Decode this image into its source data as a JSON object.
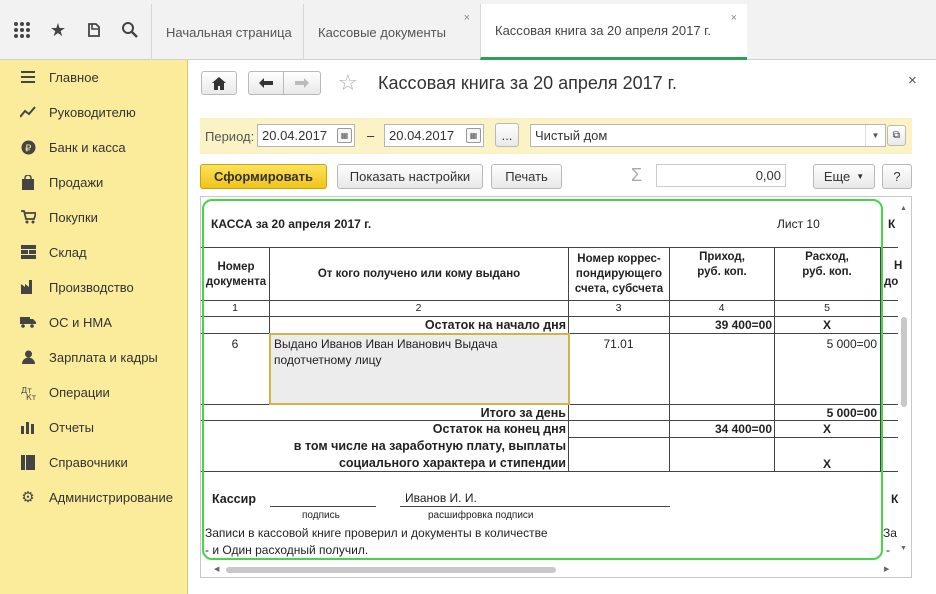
{
  "topbar": {
    "icons": [
      "grid-icon",
      "star-icon",
      "history-icon",
      "search-icon"
    ],
    "tabs": [
      {
        "label": "Начальная страница",
        "closable": false,
        "active": false
      },
      {
        "label": "Кассовые документы",
        "closable": true,
        "active": false
      },
      {
        "label": "Кассовая книга за 20 апреля 2017 г.",
        "closable": true,
        "active": true
      }
    ],
    "close_glyph": "×"
  },
  "sidebar": {
    "items": [
      {
        "label": "Главное",
        "icon": "menu-icon"
      },
      {
        "label": "Руководителю",
        "icon": "trend-icon"
      },
      {
        "label": "Банк и касса",
        "icon": "ruble-icon"
      },
      {
        "label": "Продажи",
        "icon": "bag-icon"
      },
      {
        "label": "Покупки",
        "icon": "cart-icon"
      },
      {
        "label": "Склад",
        "icon": "warehouse-icon"
      },
      {
        "label": "Производство",
        "icon": "factory-icon"
      },
      {
        "label": "ОС и НМА",
        "icon": "truck-icon"
      },
      {
        "label": "Зарплата и кадры",
        "icon": "people-icon"
      },
      {
        "label": "Операции",
        "icon": "operations-icon"
      },
      {
        "label": "Отчеты",
        "icon": "chart-icon"
      },
      {
        "label": "Справочники",
        "icon": "book-icon"
      },
      {
        "label": "Администрирование",
        "icon": "gear-icon"
      }
    ]
  },
  "header": {
    "title": "Кассовая книга за 20 апреля 2017 г.",
    "close": "×"
  },
  "params": {
    "period_label": "Период:",
    "date_from": "20.04.2017",
    "dash": "–",
    "date_to": "20.04.2017",
    "ellipsis": "...",
    "organization": "Чистый дом"
  },
  "toolbar": {
    "generate": "Сформировать",
    "show_settings": "Показать настройки",
    "print": "Печать",
    "sum_symbol": "Σ",
    "sum_value": "0,00",
    "more": "Еще",
    "help": "?"
  },
  "report": {
    "heading": "КАССА за 20 апреля 2017 г.",
    "sheet": "Лист 10",
    "col_headers": [
      "Номер документа",
      "От кого получено или кому выдано",
      "Номер коррес-пондирующего счета, субсчета",
      "Приход, руб. коп.",
      "Расход, руб. коп."
    ],
    "col_numbers": [
      "1",
      "2",
      "3",
      "4",
      "5"
    ],
    "opening": {
      "label": "Остаток на начало дня",
      "income": "39 400=00",
      "expense": "Х"
    },
    "row": {
      "number": "6",
      "description": "Выдано Иванов Иван Иванович Выдача подотчетному лицу",
      "account": "71.01",
      "income": "",
      "expense": "5 000=00"
    },
    "day_total": {
      "label": "Итого за день",
      "income": "",
      "expense": "5 000=00"
    },
    "closing": {
      "label": "Остаток на конец дня",
      "income": "34 400=00",
      "expense": "Х"
    },
    "salary": {
      "label_line1": "в том числе на заработную плату, выплаты",
      "label_line2": "социального характера и стипендии",
      "expense": "Х"
    },
    "cashier_label": "Кассир",
    "signature_caption": "подпись",
    "cashier_name": "Иванов И. И.",
    "decode_caption": "расшифровка подписи",
    "footer_line1": "Записи в кассовой книге проверил и документы в количестве",
    "footer_line2": "-  и Один расходный получил.",
    "right_cut_header": "К",
    "right_cut_col1": "Н",
    "right_cut_col2": "до",
    "right_cut_footer1": "К",
    "right_cut_footer2": "За",
    "right_cut_footer3": "-"
  }
}
